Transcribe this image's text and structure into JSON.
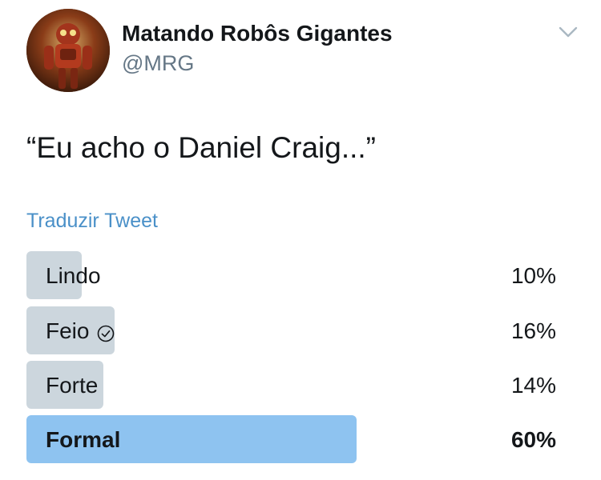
{
  "user": {
    "name": "Matando Robôs Gigantes",
    "handle": "@MRG",
    "avatar_icon": "robot-avatar"
  },
  "menu_icon": "chevron-down-icon",
  "tweet": {
    "text": "“Eu acho o Daniel Craig...”",
    "translate_label": "Traduzir Tweet"
  },
  "poll": {
    "options": [
      {
        "label": "Lindo",
        "percent_text": "10%",
        "percent": 10,
        "voted": false,
        "winner": false
      },
      {
        "label": "Feio",
        "percent_text": "16%",
        "percent": 16,
        "voted": true,
        "winner": false
      },
      {
        "label": "Forte",
        "percent_text": "14%",
        "percent": 14,
        "voted": false,
        "winner": false
      },
      {
        "label": "Formal",
        "percent_text": "60%",
        "percent": 60,
        "voted": false,
        "winner": true
      }
    ]
  },
  "colors": {
    "bar": "#ccd6dd",
    "winner_bar": "#8ec3f0",
    "link": "#4a90c8",
    "secondary_text": "#657786"
  }
}
